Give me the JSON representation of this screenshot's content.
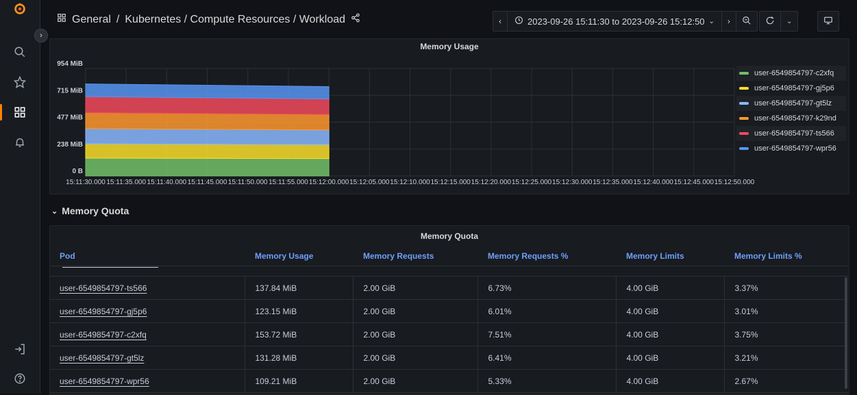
{
  "breadcrumb": {
    "folder": "General",
    "sep": "/",
    "path": "Kubernetes / Compute Resources / Workload"
  },
  "time_range": {
    "text": "2023-09-26 15:11:30 to 2023-09-26 15:12:50"
  },
  "chart_data": {
    "type": "area",
    "title": "Memory Usage",
    "yticks": [
      "954 MiB",
      "715 MiB",
      "477 MiB",
      "238 MiB",
      "0 B"
    ],
    "ylim": [
      0,
      954
    ],
    "x_ticks": [
      "15:11:30.000",
      "15:11:35.000",
      "15:11:40.000",
      "15:11:45.000",
      "15:11:50.000",
      "15:11:55.000",
      "15:12:00.000",
      "15:12:05.000",
      "15:12:10.000",
      "15:12:15.000",
      "15:12:20.000",
      "15:12:25.000",
      "15:12:30.000",
      "15:12:35.000",
      "15:12:40.000",
      "15:12:45.000",
      "15:12:50.000"
    ],
    "x": [
      "15:11:30",
      "15:12:00"
    ],
    "stacked": true,
    "grid": true,
    "legend_position": "right",
    "series": [
      {
        "name": "user-6549854797-c2xfq",
        "color": "#73bf69",
        "values": [
          158,
          154
        ]
      },
      {
        "name": "user-6549854797-gj5p6",
        "color": "#fade2a",
        "values": [
          127,
          123
        ]
      },
      {
        "name": "user-6549854797-gt5lz",
        "color": "#8ab8ff",
        "values": [
          135,
          131
        ]
      },
      {
        "name": "user-6549854797-k29nd",
        "color": "#ff9830",
        "values": [
          142,
          138
        ]
      },
      {
        "name": "user-6549854797-ts566",
        "color": "#f2495c",
        "values": [
          142,
          138
        ]
      },
      {
        "name": "user-6549854797-wpr56",
        "color": "#5794f2",
        "values": [
          113,
          109
        ]
      }
    ]
  },
  "section": {
    "title": "Memory Quota"
  },
  "quota_panel": {
    "title": "Memory Quota",
    "columns": [
      "Pod",
      "Memory Usage",
      "Memory Requests",
      "Memory Requests %",
      "Memory Limits",
      "Memory Limits %"
    ],
    "rows": [
      [
        "user-6549854797-ts566",
        "137.84 MiB",
        "2.00 GiB",
        "6.73%",
        "4.00 GiB",
        "3.37%"
      ],
      [
        "user-6549854797-gj5p6",
        "123.15 MiB",
        "2.00 GiB",
        "6.01%",
        "4.00 GiB",
        "3.01%"
      ],
      [
        "user-6549854797-c2xfq",
        "153.72 MiB",
        "2.00 GiB",
        "7.51%",
        "4.00 GiB",
        "3.75%"
      ],
      [
        "user-6549854797-gt5lz",
        "131.28 MiB",
        "2.00 GiB",
        "6.41%",
        "4.00 GiB",
        "3.21%"
      ],
      [
        "user-6549854797-wpr56",
        "109.21 MiB",
        "2.00 GiB",
        "5.33%",
        "4.00 GiB",
        "2.67%"
      ]
    ]
  }
}
